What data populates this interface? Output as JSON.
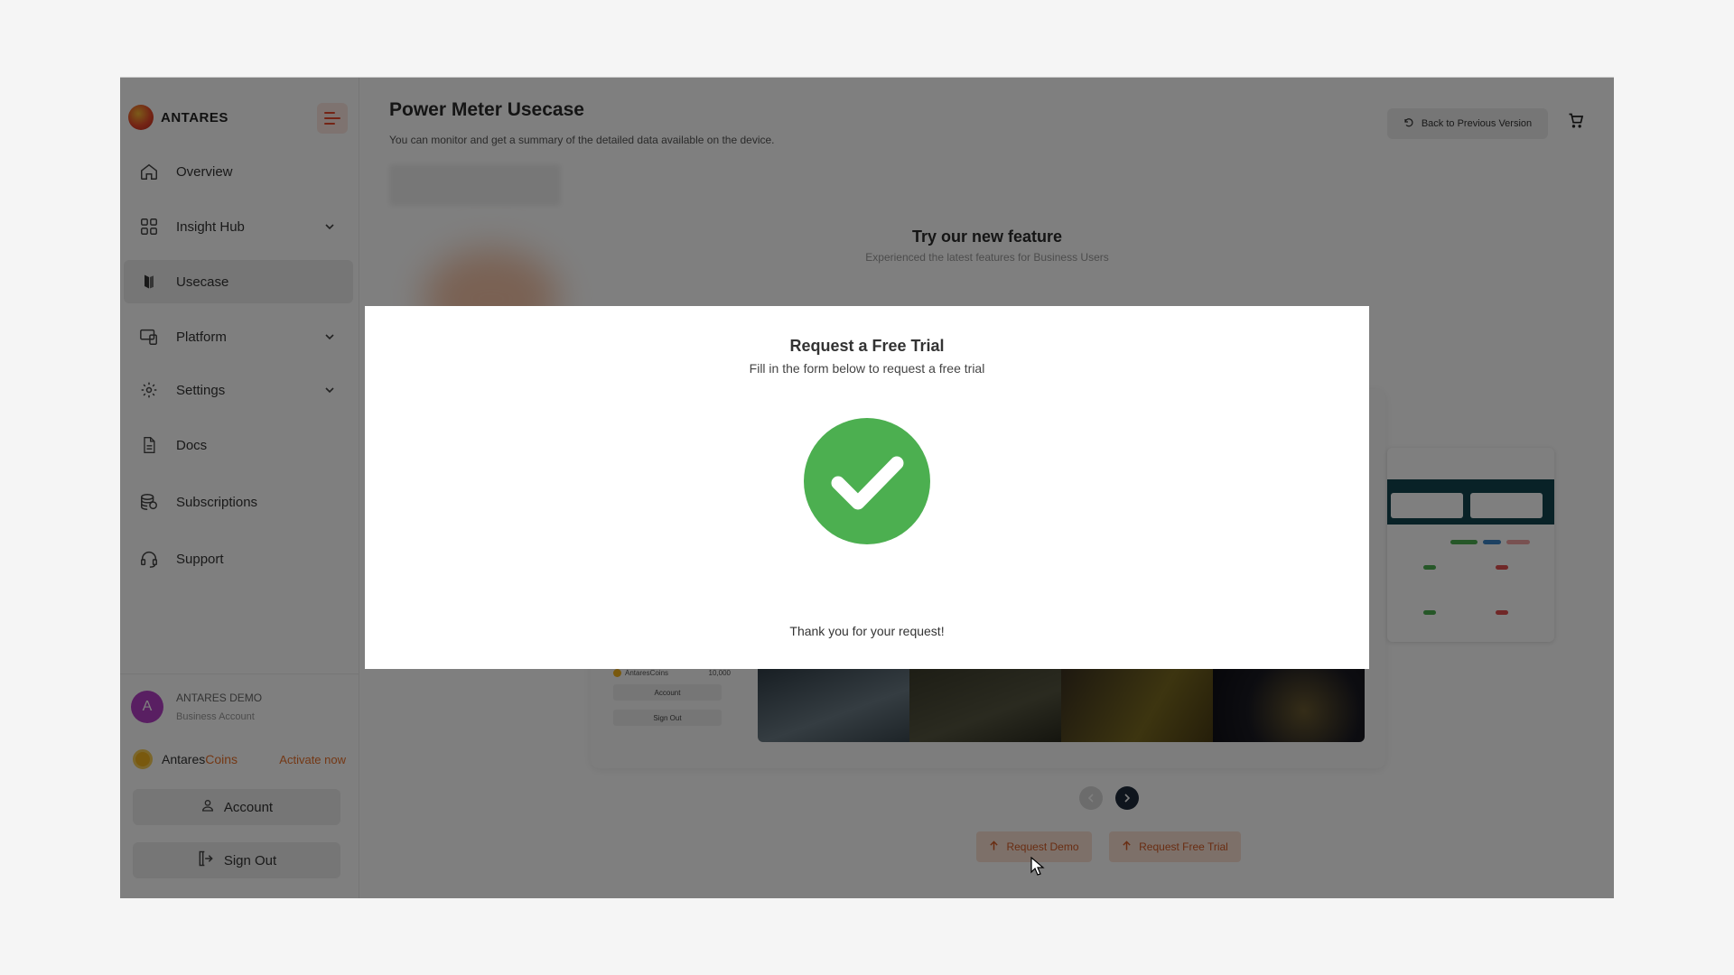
{
  "app": {
    "brand": "ANTARES"
  },
  "sidebar": {
    "items": [
      {
        "label": "Overview",
        "icon": "home-icon"
      },
      {
        "label": "Insight Hub",
        "icon": "grid-icon",
        "expandable": true
      },
      {
        "label": "Usecase",
        "icon": "usecase-icon",
        "active": true
      },
      {
        "label": "Platform",
        "icon": "devices-icon",
        "expandable": true
      },
      {
        "label": "Settings",
        "icon": "gear-icon",
        "expandable": true
      },
      {
        "label": "Docs",
        "icon": "document-icon"
      },
      {
        "label": "Subscriptions",
        "icon": "coins-stack-icon"
      },
      {
        "label": "Support",
        "icon": "headset-icon"
      }
    ],
    "user": {
      "initial": "A",
      "name": "ANTARES DEMO",
      "type": "Business Account"
    },
    "coins": {
      "label_prefix": "Antares",
      "label_accent": "Coins",
      "action": "Activate now"
    },
    "account_label": "Account",
    "signout_label": "Sign Out"
  },
  "header": {
    "title": "Power Meter Usecase",
    "subtitle": "You can monitor and get a summary of the detailed data available on the device.",
    "back_label": "Back to Previous Version"
  },
  "feature": {
    "title": "Try our new feature",
    "subtitle": "Experienced the latest features for Business Users",
    "mini_coins_label": "AntaresCoins",
    "mini_coins_value": "10,000",
    "mini_account": "Account",
    "mini_signout": "Sign Out"
  },
  "actions": {
    "request_demo": "Request Demo",
    "request_trial": "Request Free Trial"
  },
  "modal": {
    "title": "Request a Free Trial",
    "subtitle": "Fill in the form below to request a free trial",
    "message": "Thank you for your request!",
    "status": "success"
  },
  "colors": {
    "accent": "#e8702a",
    "success": "#4caf50",
    "overlay": "rgba(0,0,0,0.5)"
  }
}
